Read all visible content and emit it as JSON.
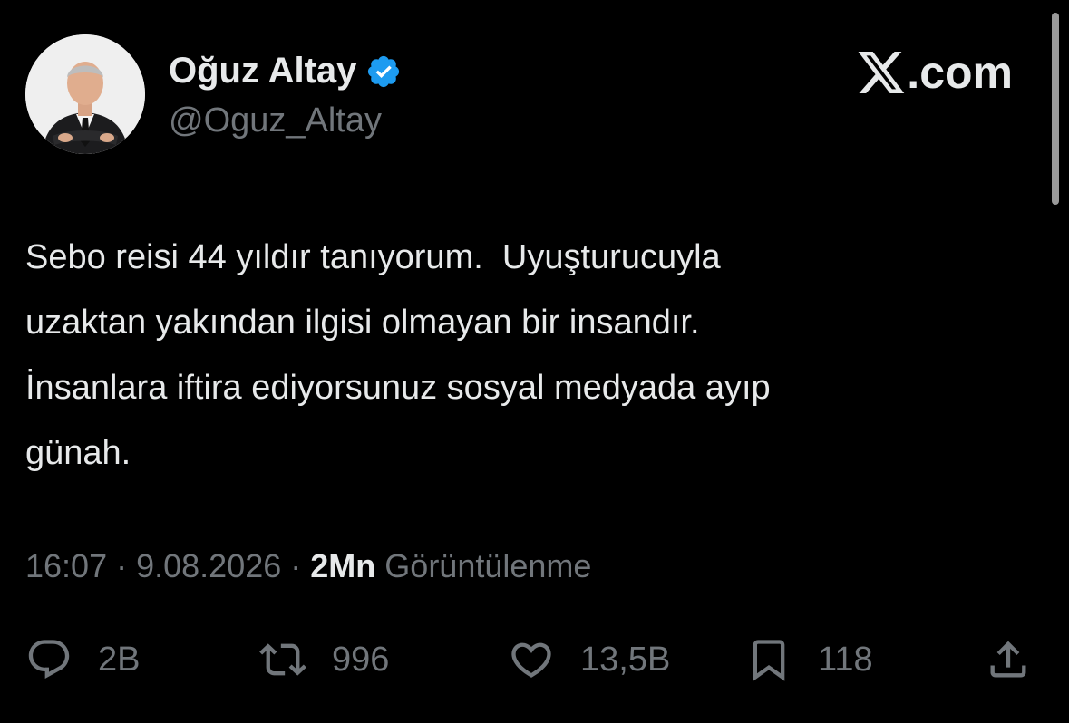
{
  "author": {
    "display_name": "Oğuz Altay",
    "handle": "@Oguz_Altay",
    "verified_color": "#1d9bf0"
  },
  "brand": {
    "suffix": ".com"
  },
  "tweet": {
    "lines": [
      "Sebo reisi 44 yıldır tanıyorum.  Uyuşturucuyla",
      "uzaktan yakından ilgisi olmayan bir insandır.",
      "İnsanlara iftira ediyorsunuz sosyal medyada ayıp",
      "günah."
    ]
  },
  "meta": {
    "time": "16:07",
    "separator": "·",
    "date": "9.08.2026",
    "views_count": "2Mn",
    "views_label": "Görüntülenme"
  },
  "actions": {
    "replies": "2B",
    "reposts": "996",
    "likes": "13,5B",
    "bookmarks": "118"
  },
  "icons": {
    "reply": "reply-icon",
    "repost": "repost-icon",
    "like": "heart-icon",
    "bookmark": "bookmark-icon",
    "share": "share-icon",
    "verified": "verified-badge-icon",
    "brand": "x-logo-icon"
  },
  "colors": {
    "background": "#000000",
    "text": "#e7e9ea",
    "secondary": "#71767b",
    "verified": "#1d9bf0"
  }
}
